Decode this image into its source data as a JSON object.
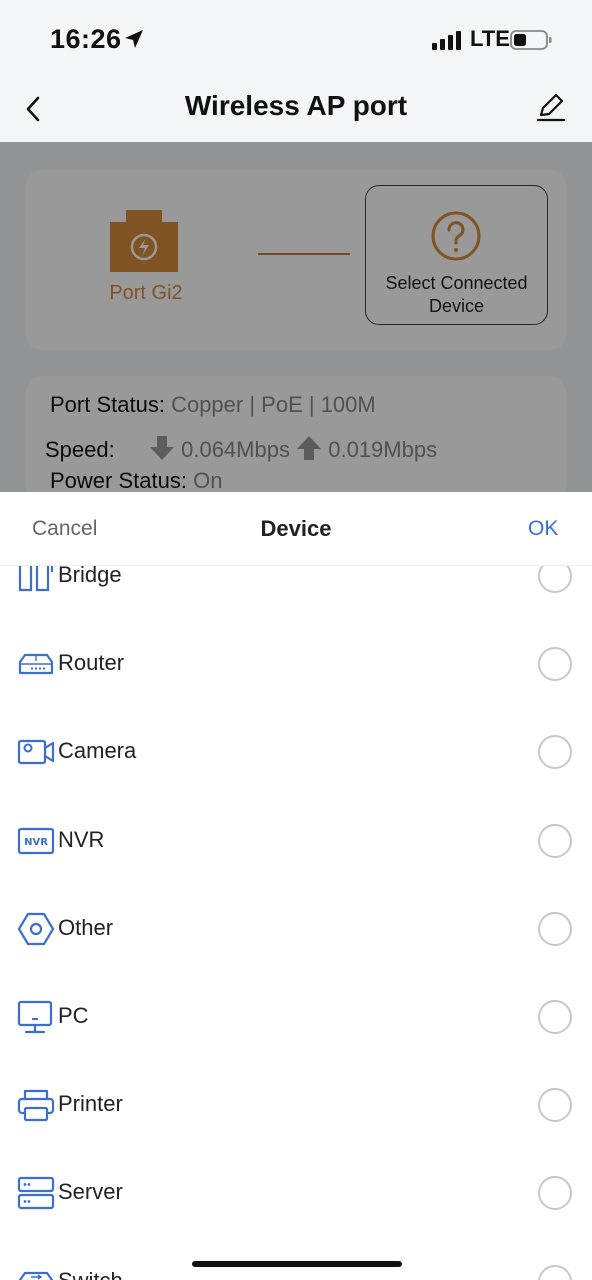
{
  "status_bar": {
    "time": "16:26",
    "network": "LTE"
  },
  "nav": {
    "title": "Wireless AP port"
  },
  "port": {
    "label": "Port Gi2",
    "select_device_label": "Select Connected Device"
  },
  "port_status": {
    "status_key": "Port Status:",
    "status_value": "Copper | PoE | 100M",
    "speed_key": "Speed:",
    "download": "0.064Mbps",
    "upload": "0.019Mbps",
    "power_key": "Power Status:",
    "power_value": "On"
  },
  "sheet": {
    "cancel": "Cancel",
    "title": "Device",
    "ok": "OK",
    "items": [
      {
        "label": "Bridge",
        "icon": "bridge-icon"
      },
      {
        "label": "Router",
        "icon": "router-icon"
      },
      {
        "label": "Camera",
        "icon": "camera-icon"
      },
      {
        "label": "NVR",
        "icon": "nvr-icon"
      },
      {
        "label": "Other",
        "icon": "other-icon"
      },
      {
        "label": "PC",
        "icon": "pc-icon"
      },
      {
        "label": "Printer",
        "icon": "printer-icon"
      },
      {
        "label": "Server",
        "icon": "server-icon"
      },
      {
        "label": "Switch",
        "icon": "switch-icon"
      }
    ]
  },
  "colors": {
    "accent": "#3a6fd0",
    "port": "#d48a3a",
    "icon": "#3a6fd0"
  }
}
